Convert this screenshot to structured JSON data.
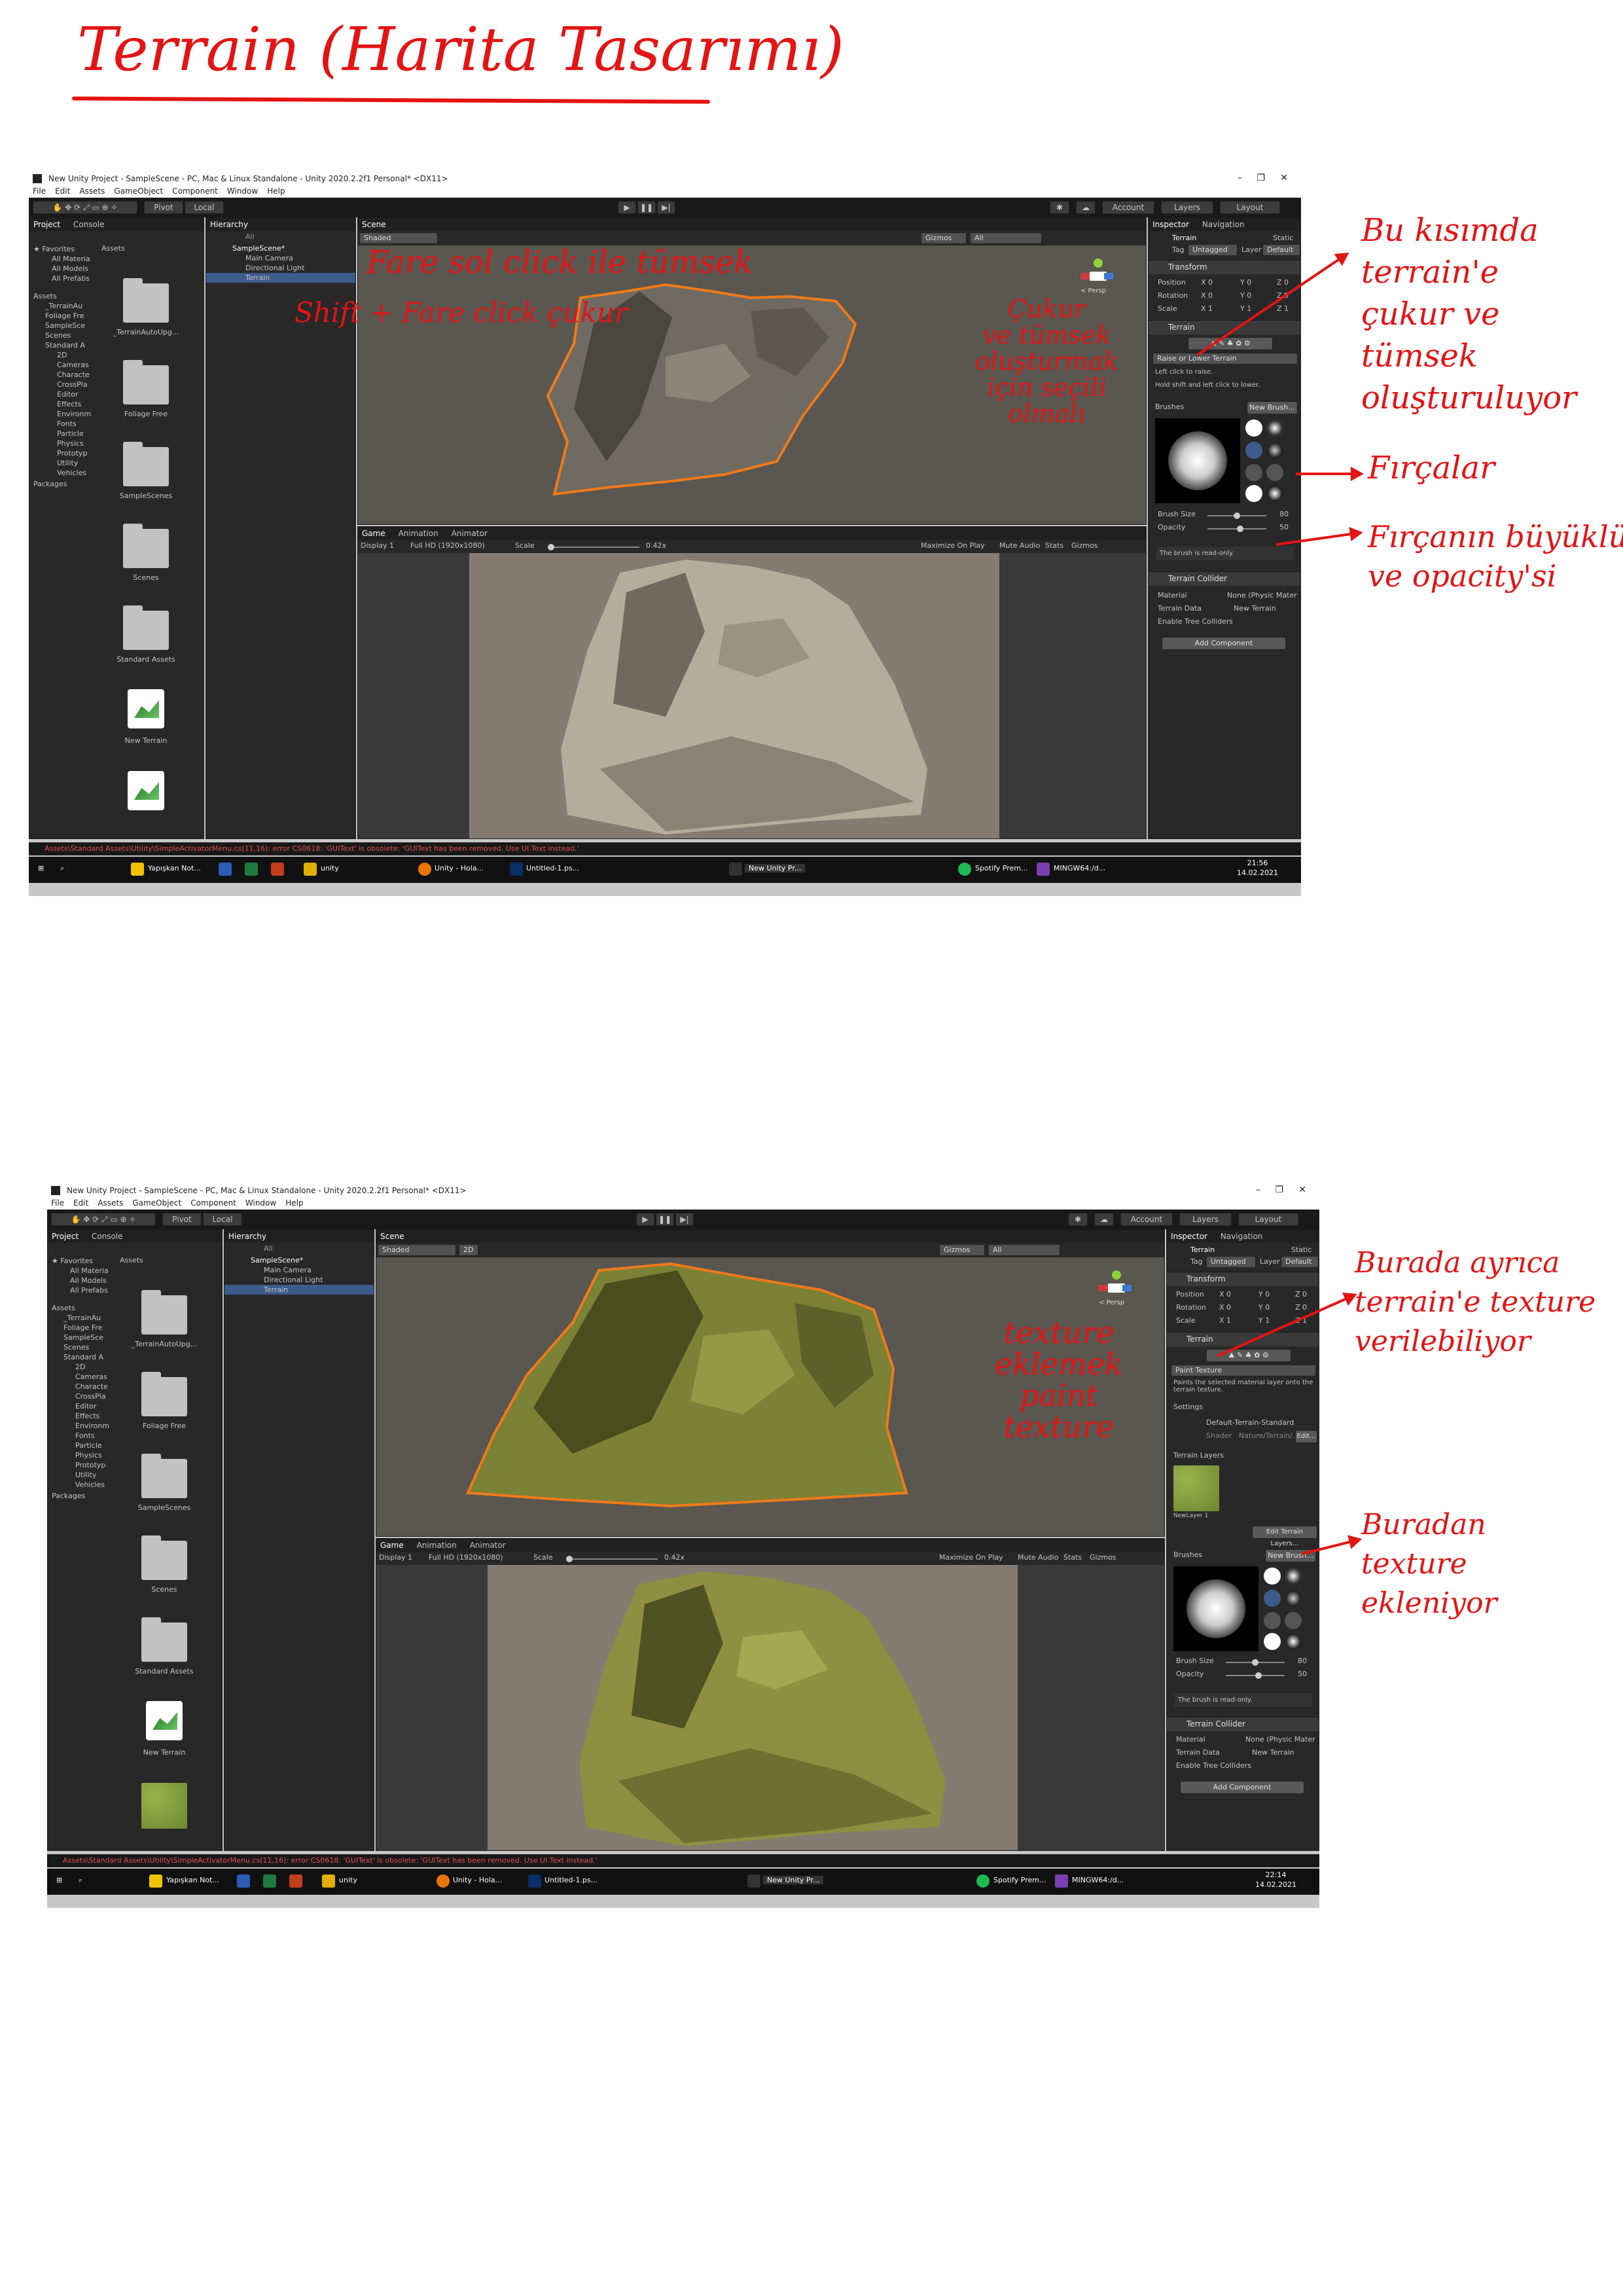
{
  "page_title": "Terrain (Harita Tasarımı)",
  "window": {
    "title": "New Unity Project - SampleScene - PC, Mac & Linux Standalone - Unity 2020.2.2f1 Personal* <DX11>",
    "menu": [
      "File",
      "Edit",
      "Assets",
      "GameObject",
      "Component",
      "Window",
      "Help"
    ],
    "pivot": "Pivot",
    "local": "Local",
    "account": "Account",
    "layers": "Layers",
    "layout": "Layout"
  },
  "project_panel": {
    "tabs": [
      "Project",
      "Console"
    ],
    "tree": [
      "★ Favorites",
      "All Materia",
      "All Models",
      "All Prefabs",
      "Assets",
      "_TerrainAu",
      "Foliage Fre",
      "SampleSce",
      "Scenes",
      "Standard A",
      "2D",
      "Cameras",
      "Characte",
      "CrossPla",
      "Editor",
      "Effects",
      "Environm",
      "Fonts",
      "Particle",
      "Physics",
      "Prototyp",
      "Utility",
      "Vehicles",
      "Packages"
    ],
    "assets_header": "Assets",
    "assets_1": [
      "_TerrainAutoUpg...",
      "Foliage Free",
      "SampleScenes",
      "Scenes",
      "Standard Assets",
      "New Terrain"
    ],
    "assets_2": [
      "_TerrainAutoUpg...",
      "Foliage Free",
      "SampleScenes",
      "Scenes",
      "Standard Assets",
      "New Terrain"
    ]
  },
  "hierarchy": {
    "tab": "Hierarchy",
    "search": "All",
    "items": [
      "SampleScene*",
      "Main Camera",
      "Directional Light",
      "Terrain"
    ]
  },
  "scene": {
    "tab": "Scene",
    "shading": "Shaded",
    "mode2d": "2D",
    "gizmos": "Gizmos",
    "search": "All",
    "persp": "< Persp"
  },
  "game": {
    "tabs": [
      "Game",
      "Animation",
      "Animator"
    ],
    "display": "Display 1",
    "resolution": "Full HD (1920x1080)",
    "scale_label": "Scale",
    "scale_value": "0.42x",
    "maximize": "Maximize On Play",
    "mute": "Mute Audio",
    "stats": "Stats",
    "gizmos": "Gizmos"
  },
  "inspector": {
    "tabs": [
      "Inspector",
      "Navigation"
    ],
    "object_name": "Terrain",
    "static": "Static",
    "tag_label": "Tag",
    "tag_value": "Untagged",
    "layer_label": "Layer",
    "layer_value": "Default",
    "transform": "Transform",
    "position": "Position",
    "rotation": "Rotation",
    "scale": "Scale",
    "pos_vals": [
      "X 0",
      "Y 0",
      "Z 0"
    ],
    "rot_vals": [
      "X 0",
      "Y 0",
      "Z 0"
    ],
    "scale_vals": [
      "X 1",
      "Y 1",
      "Z 1"
    ],
    "terrain_comp": "Terrain",
    "tool_1": "Raise or Lower Terrain",
    "tool_1_help_1": "Left click to raise.",
    "tool_1_help_2": "Hold shift and left click to lower.",
    "tool_2": "Paint Texture",
    "tool_2_help": "Paints the selected material layer onto the terrain texture.",
    "settings": "Settings",
    "material": "Default-Terrain-Standard",
    "shader_label": "Shader",
    "shader_value": "Nature/Terrain/…",
    "edit": "Edit...",
    "terrain_layers": "Terrain Layers",
    "new_layer": "NewLayer 1",
    "edit_layers": "Edit Terrain Layers...",
    "brushes": "Brushes",
    "new_brush": "New Brush...",
    "brush_size_label": "Brush Size",
    "brush_size": "80",
    "opacity_label": "Opacity",
    "opacity": "50",
    "readonly": "The brush is read-only.",
    "collider": "Terrain Collider",
    "material_label": "Material",
    "material_value": "None (Physic Mater",
    "terrain_data_label": "Terrain Data",
    "terrain_data_value": "New Terrain",
    "tree_colliders": "Enable Tree Colliders",
    "add_component": "Add Component"
  },
  "status_1": "Assets\\Standard Assets\\Utility\\SimpleActivatorMenu.cs(11,16): error CS0618: 'GUIText' is obsolete: 'GUIText has been removed. Use UI.Text instead.'",
  "status_2": "Assets\\Standard Assets\\Utility\\SimpleActivatorMenu.cs(11,16): error CS0618: 'GUIText' is obsolete: 'GUIText has been removed. Use UI.Text instead.'",
  "taskbar": {
    "items": [
      "Yapışkan Not...",
      "unity",
      "Unity - Hola...",
      "Untitled-1.ps...",
      "New Unity Pr...",
      "Spotify Prem...",
      "MINGW64:/d..."
    ],
    "time_1": "21:56",
    "date_1": "14.02.2021",
    "time_2": "22:14",
    "date_2": "14.02.2021"
  },
  "notes": {
    "n1": "Fare sol click ile tümsek",
    "n2": "Shift + Fare click çukur",
    "n3": [
      "Çukur",
      "ve tümsek",
      "oluşturmak",
      "için seçili",
      "olmalı"
    ],
    "n4": [
      "Bu kısımda",
      "terrain'e",
      "çukur ve",
      "tümsek",
      "oluşturuluyor"
    ],
    "n5": "Fırçalar",
    "n6": [
      "Fırçanın büyüklüğü",
      "ve opacity'si"
    ],
    "n7": [
      "texture",
      "eklemek",
      "paint",
      "texture"
    ],
    "n8": [
      "Burada ayrıca",
      "terrain'e texture",
      "verilebiliyor"
    ],
    "n9": [
      "Buradan",
      "texture",
      "ekleniyor"
    ]
  }
}
